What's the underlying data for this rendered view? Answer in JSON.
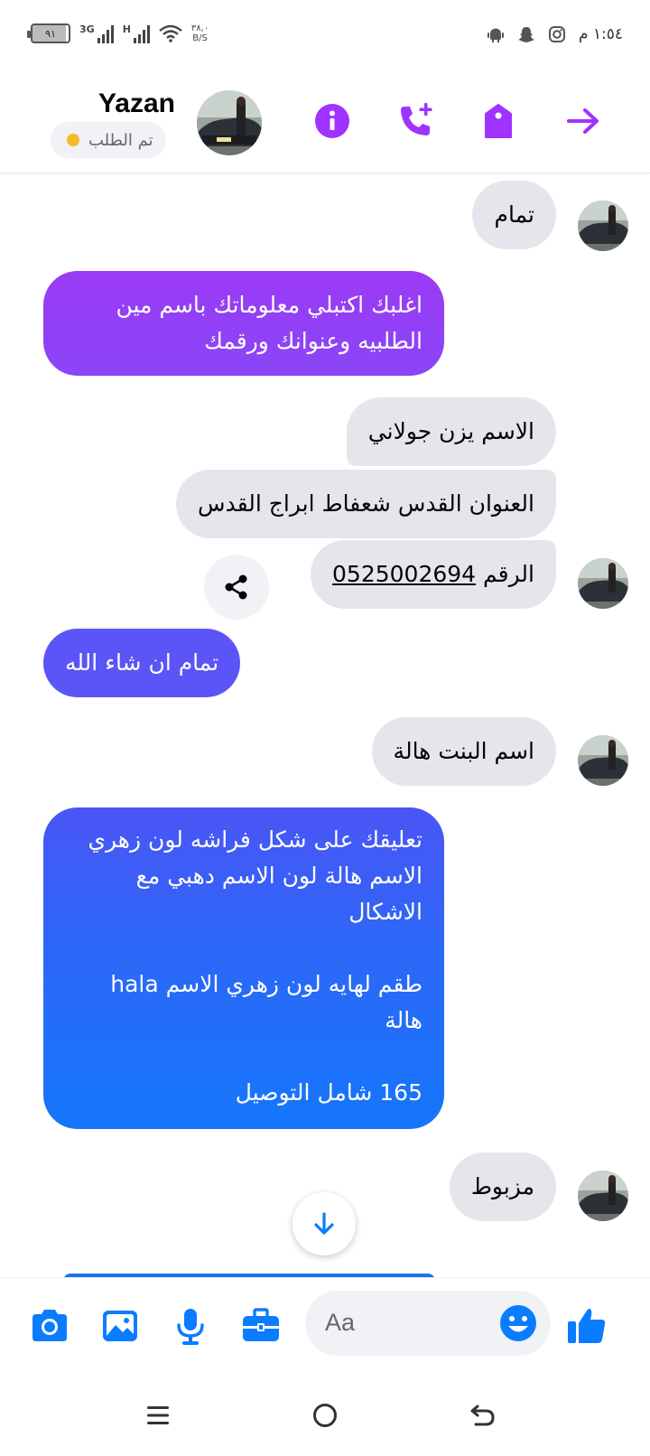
{
  "status_bar": {
    "battery": "٩١",
    "network_1": "3G",
    "network_2": "H",
    "speed_value": "٣٨,٠",
    "speed_unit": "B/S",
    "time": "١:٥٤ م",
    "icons": [
      "android-icon",
      "snapchat-icon",
      "instagram-icon"
    ]
  },
  "header": {
    "contact_name": "Yazan",
    "status_text": "تم الطلب",
    "status_color": "#f7b928",
    "icons": [
      "info-icon",
      "add-call-icon",
      "tag-icon",
      "forward-arrow-icon"
    ],
    "accent_color": "#a033ff"
  },
  "messages": [
    {
      "side": "incoming",
      "text": "تمام"
    },
    {
      "side": "outgoing",
      "lines": [
        "اغلبك اكتبلي معلوماتك باسم مين",
        "الطلبيه وعنوانك ورقمك"
      ]
    },
    {
      "side": "incoming",
      "text": "الاسم يزن جولاني"
    },
    {
      "side": "incoming",
      "text": "العنوان القدس شعفاط ابراج القدس"
    },
    {
      "side": "incoming",
      "label": "الرقم",
      "phone": "0525002694"
    },
    {
      "side": "outgoing",
      "text": "تمام ان شاء الله"
    },
    {
      "side": "incoming",
      "text": "اسم البنت هالة"
    },
    {
      "side": "outgoing",
      "lines": [
        "تعليقك على شكل فراشه لون زهري",
        "الاسم هالة لون الاسم دهبي مع",
        "الاشكال",
        "",
        "طقم لهايه لون زهري الاسم hala",
        "هالة",
        "",
        "165 شامل التوصيل"
      ]
    },
    {
      "side": "incoming",
      "text": "مزبوط"
    }
  ],
  "composer": {
    "placeholder": "Aa",
    "icons": [
      "camera-icon",
      "gallery-icon",
      "microphone-icon",
      "briefcase-icon",
      "emoji-icon",
      "thumbs-up-icon"
    ],
    "icon_color": "#0a7cff"
  },
  "nav_bar": {
    "icons": [
      "recent-apps-icon",
      "home-icon",
      "back-icon"
    ]
  }
}
